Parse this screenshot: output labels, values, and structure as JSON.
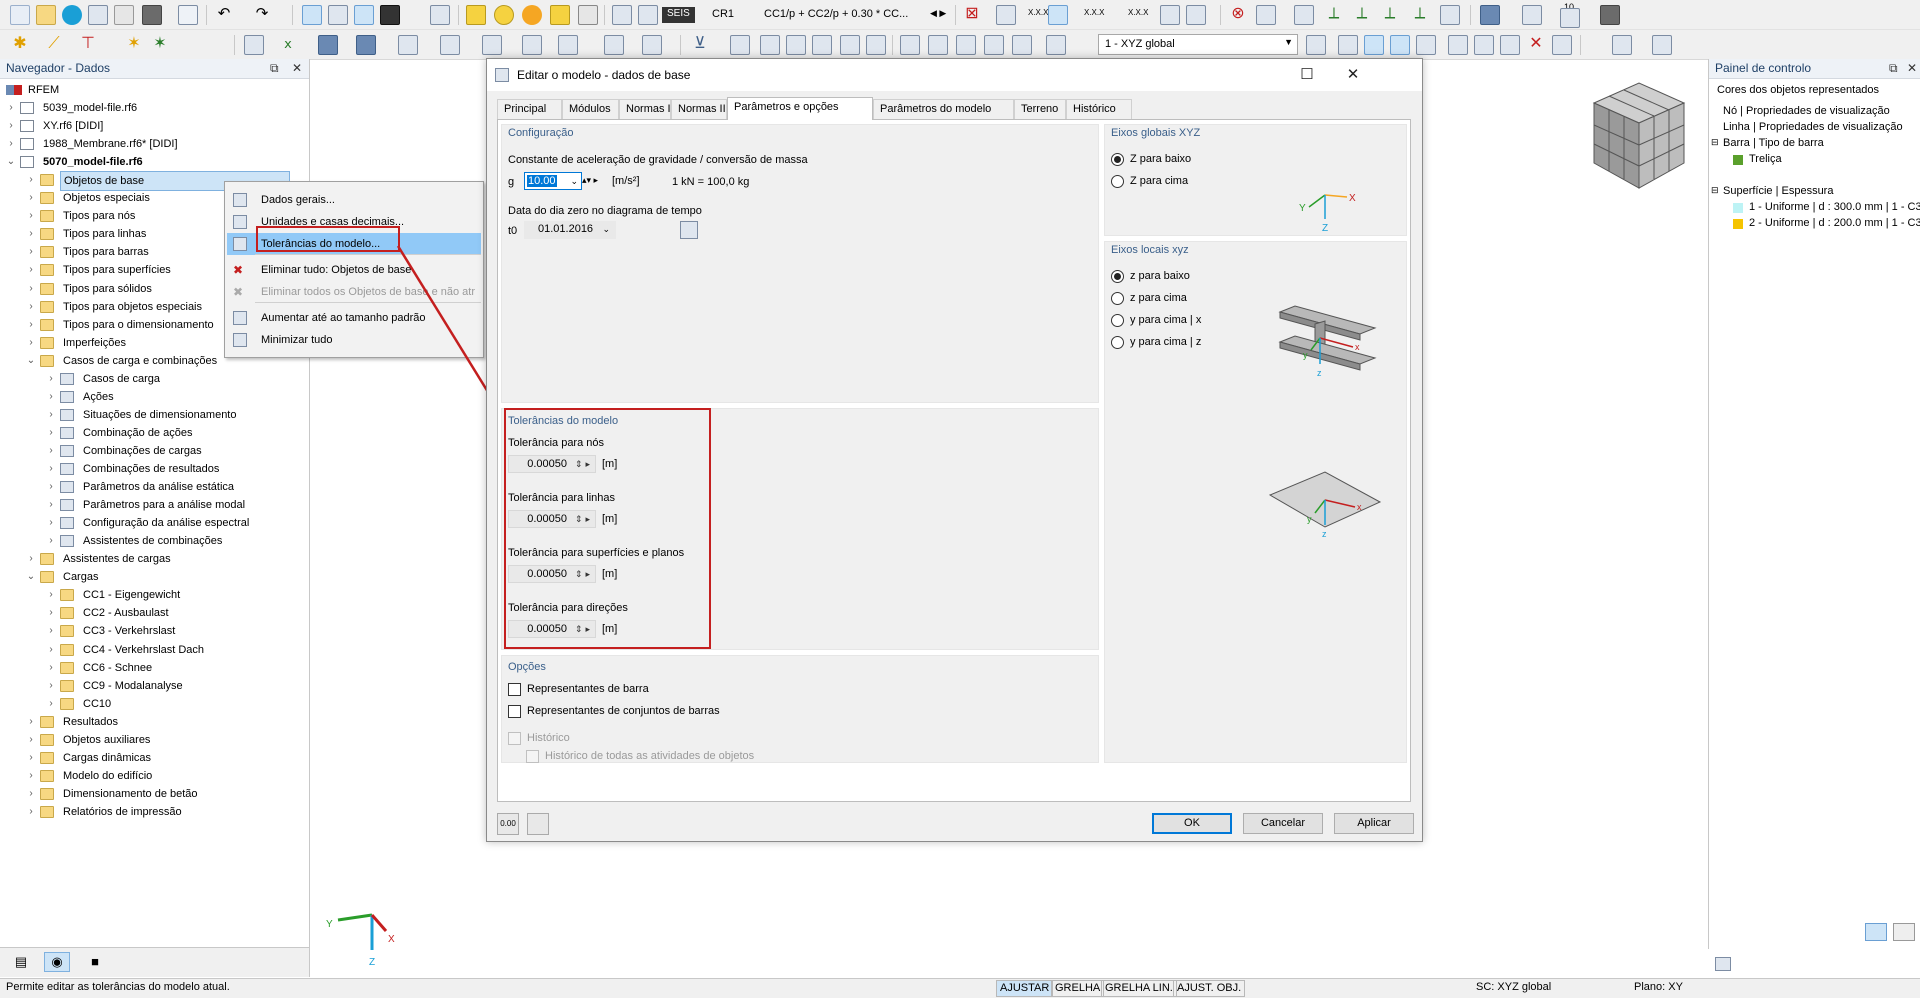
{
  "toolbar": {
    "load_case_tag": "SEIS",
    "load_case": "CR1",
    "combination_combo": "CC1/p + CC2/p + 0.30 * CC...",
    "view_combo": "1 - XYZ global",
    "xxx_label": "X.X.X",
    "num_label": "10"
  },
  "navigator": {
    "title": "Navegador - Dados",
    "root": "RFEM",
    "items": [
      {
        "label": "5039_model-file.rf6",
        "level": 1,
        "icon": "file"
      },
      {
        "label": "XY.rf6 [DIDI]",
        "level": 1,
        "icon": "file"
      },
      {
        "label": "1988_Membrane.rf6* [DIDI]",
        "level": 1,
        "icon": "file"
      },
      {
        "label": "5070_model-file.rf6",
        "level": 1,
        "icon": "file",
        "bold": true
      },
      {
        "label": "Objetos de base",
        "level": 2,
        "icon": "folder",
        "selected": true
      },
      {
        "label": "Objetos especiais",
        "level": 2,
        "icon": "folder"
      },
      {
        "label": "Tipos para nós",
        "level": 2,
        "icon": "folder"
      },
      {
        "label": "Tipos para linhas",
        "level": 2,
        "icon": "folder"
      },
      {
        "label": "Tipos para barras",
        "level": 2,
        "icon": "folder"
      },
      {
        "label": "Tipos para superfícies",
        "level": 2,
        "icon": "folder"
      },
      {
        "label": "Tipos para sólidos",
        "level": 2,
        "icon": "folder"
      },
      {
        "label": "Tipos para objetos especiais",
        "level": 2,
        "icon": "folder"
      },
      {
        "label": "Tipos para o dimensionamento",
        "level": 2,
        "icon": "folder"
      },
      {
        "label": "Imperfeições",
        "level": 2,
        "icon": "folder"
      },
      {
        "label": "Casos de carga e combinações",
        "level": 2,
        "icon": "folder",
        "open": true
      },
      {
        "label": "Casos de carga",
        "level": 3,
        "icon": "tool"
      },
      {
        "label": "Ações",
        "level": 3,
        "icon": "tool"
      },
      {
        "label": "Situações de dimensionamento",
        "level": 3,
        "icon": "tool"
      },
      {
        "label": "Combinação de ações",
        "level": 3,
        "icon": "tool"
      },
      {
        "label": "Combinações de cargas",
        "level": 3,
        "icon": "tool"
      },
      {
        "label": "Combinações de resultados",
        "level": 3,
        "icon": "tool"
      },
      {
        "label": "Parâmetros da análise estática",
        "level": 3,
        "icon": "tool"
      },
      {
        "label": "Parâmetros para a análise modal",
        "level": 3,
        "icon": "tool"
      },
      {
        "label": "Configuração da análise espectral",
        "level": 3,
        "icon": "tool"
      },
      {
        "label": "Assistentes de combinações",
        "level": 3,
        "icon": "tool"
      },
      {
        "label": "Assistentes de cargas",
        "level": 2,
        "icon": "folder"
      },
      {
        "label": "Cargas",
        "level": 2,
        "icon": "folder",
        "open": true
      },
      {
        "label": "CC1 - Eigengewicht",
        "level": 3,
        "icon": "folder"
      },
      {
        "label": "CC2 - Ausbaulast",
        "level": 3,
        "icon": "folder"
      },
      {
        "label": "CC3 - Verkehrslast",
        "level": 3,
        "icon": "folder"
      },
      {
        "label": "CC4 - Verkehrslast Dach",
        "level": 3,
        "icon": "folder"
      },
      {
        "label": "CC6 - Schnee",
        "level": 3,
        "icon": "folder"
      },
      {
        "label": "CC9 - Modalanalyse",
        "level": 3,
        "icon": "folder"
      },
      {
        "label": "CC10",
        "level": 3,
        "icon": "folder"
      },
      {
        "label": "Resultados",
        "level": 2,
        "icon": "folder"
      },
      {
        "label": "Objetos auxiliares",
        "level": 2,
        "icon": "folder"
      },
      {
        "label": "Cargas dinâmicas",
        "level": 2,
        "icon": "folder"
      },
      {
        "label": "Modelo do edifício",
        "level": 2,
        "icon": "folder"
      },
      {
        "label": "Dimensionamento de betão",
        "level": 2,
        "icon": "folder"
      },
      {
        "label": "Relatórios de impressão",
        "level": 2,
        "icon": "folder"
      }
    ]
  },
  "context_menu": {
    "items": [
      {
        "label": "Dados gerais...",
        "icon": "grid-icon"
      },
      {
        "label": "Unidades e casas decimais...",
        "icon": "decimals-icon"
      },
      {
        "label": "Tolerâncias do modelo...",
        "icon": "tolerance-icon",
        "highlighted": true
      },
      {
        "label": "Eliminar tudo: Objetos de base",
        "icon": "delete-icon"
      },
      {
        "label": "Eliminar todos os Objetos de base e não atr",
        "icon": "delete-grey-icon",
        "disabled": true
      },
      {
        "label": "Aumentar até ao tamanho padrão",
        "icon": "expand-icon"
      },
      {
        "label": "Minimizar tudo",
        "icon": "collapse-icon"
      }
    ]
  },
  "dialog": {
    "title": "Editar o modelo - dados de base",
    "tabs": [
      "Principal",
      "Módulos",
      "Normas I",
      "Normas II",
      "Parâmetros e opções",
      "Parâmetros do modelo",
      "Terreno",
      "Histórico"
    ],
    "active_tab": "Parâmetros e opções",
    "config": {
      "title": "Configuração",
      "gravity_label": "Constante de aceleração de gravidade / conversão de massa",
      "g_symbol": "g",
      "g_value": "10.00",
      "g_unit": "[m/s²]",
      "mass_conversion": "1 kN = 100,0 kg",
      "date_label": "Data do dia zero no diagrama de tempo",
      "t0_symbol": "t0",
      "date_value": "01.01.2016"
    },
    "tolerances": {
      "title": "Tolerâncias do modelo",
      "items": [
        {
          "label": "Tolerância para nós",
          "value": "0.00050",
          "unit": "[m]"
        },
        {
          "label": "Tolerância para linhas",
          "value": "0.00050",
          "unit": "[m]"
        },
        {
          "label": "Tolerância para superfícies e planos",
          "value": "0.00050",
          "unit": "[m]"
        },
        {
          "label": "Tolerância para direções",
          "value": "0.00050",
          "unit": "[m]"
        }
      ]
    },
    "options": {
      "title": "Opções",
      "member_reps": "Representantes de barra",
      "member_set_reps": "Representantes de conjuntos de barras",
      "history": "Histórico",
      "history_all": "Histórico de todas as atividades de objetos"
    },
    "global_axes": {
      "title": "Eixos globais XYZ",
      "z_down": "Z para baixo",
      "z_up": "Z para cima",
      "labels": {
        "x": "X",
        "y": "Y",
        "z": "Z"
      }
    },
    "local_axes": {
      "title": "Eixos locais xyz",
      "z_down": "z para baixo",
      "z_up": "z para cima",
      "y_up_x": "y para cima | x",
      "y_up_z": "y para cima | z",
      "labels": {
        "x": "x",
        "y": "y",
        "z": "z"
      }
    },
    "buttons": {
      "ok": "OK",
      "cancel": "Cancelar",
      "apply": "Aplicar"
    },
    "footer_icon_label": "0.00"
  },
  "control_panel": {
    "title": "Painel de controlo",
    "subtitle": "Cores dos objetos representados",
    "rows": [
      {
        "label": "Nó | Propriedades de visualização"
      },
      {
        "label": "Linha | Propriedades de visualização"
      },
      {
        "label": "Barra | Tipo de barra"
      },
      {
        "label": "Treliça",
        "color": "#5aa02c"
      },
      {
        "label": "Superfície | Espessura"
      },
      {
        "label": "1 - Uniforme | d : 300.0 mm | 1 - C3",
        "color": "#bdf3f5"
      },
      {
        "label": "2 - Uniforme | d : 200.0 mm | 1 - C3",
        "color": "#f5c400"
      }
    ]
  },
  "viewport_axes": {
    "x": "X",
    "y": "Y",
    "z": "Z"
  },
  "statusbar": {
    "message": "Permite editar as tolerâncias do modelo atual.",
    "buttons": [
      "AJUSTAR",
      "GRELHA",
      "GRELHA LIN.",
      "AJUST. OBJ."
    ],
    "coord_system": "SC: XYZ global",
    "plane": "Plano: XY"
  },
  "colors": {
    "accent": "#0078d7",
    "highlight_red": "#c41f1f",
    "selection": "#cde4f7",
    "panel_title": "#3a5f8a"
  }
}
